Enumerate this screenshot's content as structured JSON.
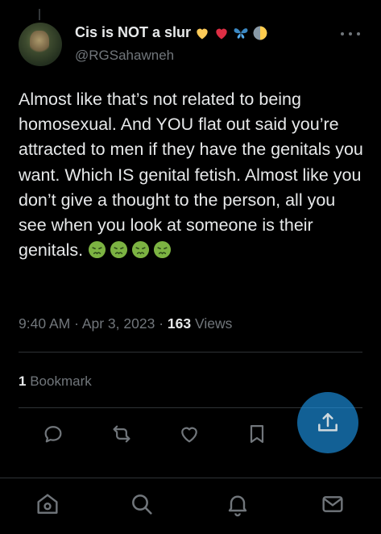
{
  "author": {
    "display_name": "Cis is NOT a slur",
    "handle": "@RGSahawneh",
    "name_emojis": [
      "yellow-heart",
      "red-heart",
      "butterfly",
      "half-moon"
    ]
  },
  "tweet": {
    "text": "Almost like that’s not related to being homosexual. And YOU flat out said you’re attracted to men if they have the genitals you want. Which IS genital fetish. Almost like you don’t give a thought to the person, all you see when you look at someone is their genitals.",
    "trailing_emoji": "nauseated-face",
    "trailing_emoji_count": 4,
    "time": "9:40 AM",
    "date": "Apr 3, 2023",
    "views_count": "163",
    "views_label": "Views",
    "separator": "·"
  },
  "engagement": {
    "bookmark_count": "1",
    "bookmark_label": "Bookmark"
  },
  "actions": [
    "reply-icon",
    "retweet-icon",
    "like-icon",
    "bookmark-icon",
    "share-icon"
  ],
  "bottom_nav": [
    "home-icon",
    "search-icon",
    "notifications-icon",
    "messages-icon"
  ],
  "colors": {
    "background": "#000000",
    "text_primary": "#e7e9ea",
    "text_secondary": "#71767b",
    "divider": "#2f3336",
    "accent": "#1d9bf0",
    "emoji_green": "#7cb342"
  }
}
